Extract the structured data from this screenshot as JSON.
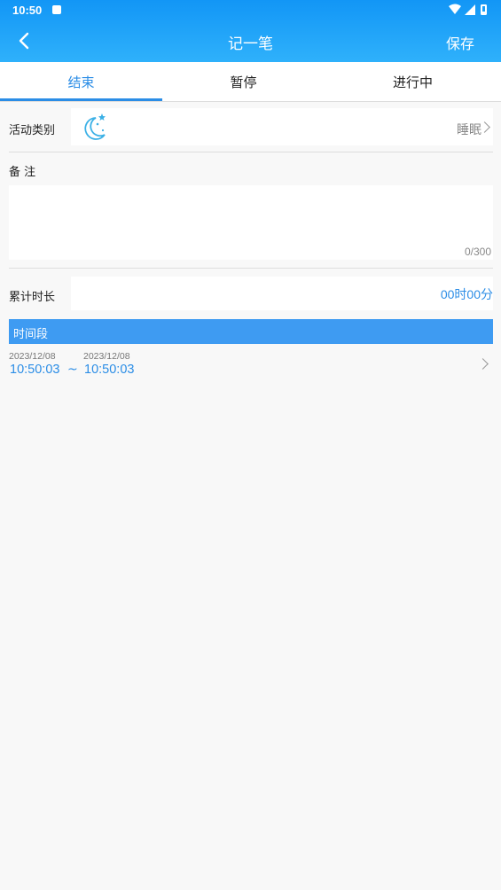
{
  "status_bar": {
    "time": "10:50"
  },
  "nav": {
    "title": "记一笔",
    "save_label": "保存"
  },
  "tabs": [
    {
      "label": "结束",
      "active": true
    },
    {
      "label": "暂停",
      "active": false
    },
    {
      "label": "进行中",
      "active": false
    }
  ],
  "category": {
    "label": "活动类别",
    "icon": "moon-stars-icon",
    "value": "睡眠"
  },
  "note": {
    "label": "备 注",
    "value": "",
    "count": "0/300"
  },
  "duration": {
    "label": "累计时长",
    "value": "00时00分"
  },
  "period": {
    "header": "时间段",
    "start_date": "2023/12/08",
    "start_time": "10:50:03",
    "separator": "~",
    "end_date": "2023/12/08",
    "end_time": "10:50:03"
  },
  "colors": {
    "accent": "#2b8de6",
    "header": "#1a9ef8",
    "section": "#3e9bf2"
  }
}
